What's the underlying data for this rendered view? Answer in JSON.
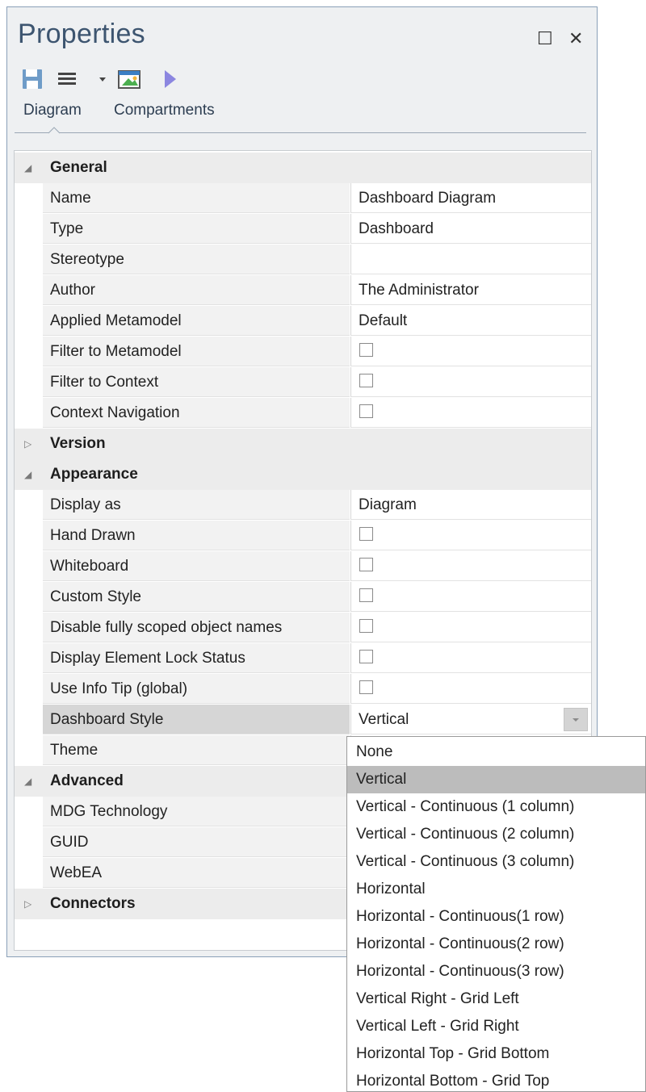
{
  "window": {
    "title": "Properties",
    "maximize_glyph": "☐",
    "close_glyph": "✕"
  },
  "toolbar": {
    "icons": [
      "save-icon",
      "menu-lines-icon",
      "dropdown-caret-icon",
      "image-properties-icon",
      "play-arrow-icon"
    ]
  },
  "tabs": [
    {
      "label": "Diagram",
      "active": true
    },
    {
      "label": "Compartments",
      "active": false
    }
  ],
  "grid": {
    "general": {
      "label": "General",
      "rows": [
        {
          "label": "Name",
          "value": "Dashboard Diagram"
        },
        {
          "label": "Type",
          "value": "Dashboard"
        },
        {
          "label": "Stereotype",
          "value": ""
        },
        {
          "label": "Author",
          "value": "The Administrator"
        },
        {
          "label": "Applied Metamodel",
          "value": "Default"
        },
        {
          "label": "Filter to Metamodel",
          "checked": false
        },
        {
          "label": "Filter to Context",
          "checked": false
        },
        {
          "label": "Context Navigation",
          "checked": false
        }
      ]
    },
    "version": {
      "label": "Version"
    },
    "appearance": {
      "label": "Appearance",
      "rows": [
        {
          "label": "Display as",
          "value": "Diagram"
        },
        {
          "label": "Hand Drawn",
          "checked": false
        },
        {
          "label": "Whiteboard",
          "checked": false
        },
        {
          "label": "Custom Style",
          "checked": false
        },
        {
          "label": "Disable fully scoped object names",
          "checked": false
        },
        {
          "label": "Display Element Lock Status",
          "checked": false
        },
        {
          "label": "Use Info Tip (global)",
          "checked": false
        },
        {
          "label": "Dashboard Style",
          "value": "Vertical"
        },
        {
          "label": "Theme",
          "value": ""
        }
      ]
    },
    "advanced": {
      "label": "Advanced",
      "rows": [
        {
          "label": "MDG Technology"
        },
        {
          "label": "GUID"
        },
        {
          "label": "WebEA"
        }
      ]
    },
    "connectors": {
      "label": "Connectors"
    }
  },
  "dropdown": {
    "selected": "Vertical",
    "options": [
      "None",
      "Vertical",
      "Vertical - Continuous (1 column)",
      "Vertical - Continuous (2 column)",
      "Vertical - Continuous (3 column)",
      "Horizontal",
      "Horizontal - Continuous(1 row)",
      "Horizontal - Continuous(2 row)",
      "Horizontal - Continuous(3 row)",
      "Vertical Right - Grid Left",
      "Vertical Left - Grid Right",
      "Horizontal Top - Grid Bottom",
      "Horizontal Bottom - Grid Top"
    ]
  }
}
